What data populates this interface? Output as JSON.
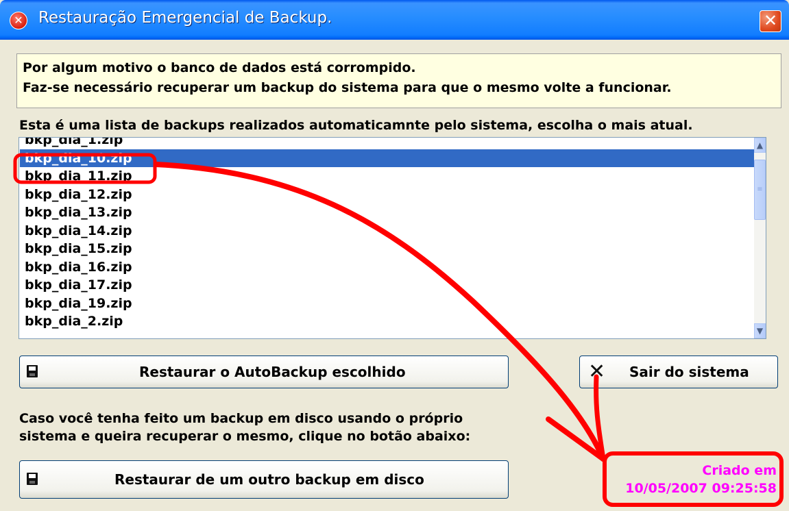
{
  "window": {
    "title": "Restauração Emergencial de Backup.",
    "close_icon": "close-icon",
    "title_icon": "error-icon"
  },
  "info": {
    "line1": "Por algum motivo o banco de dados está corrompido.",
    "line2": "Faz-se necessário recuperar um backup do sistema para que o mesmo volte a funcionar."
  },
  "backup_list": {
    "label": "Esta é uma lista de backups realizados automaticamnte pelo sistema, escolha o mais atual.",
    "items": [
      "bkp_dia_1.zip",
      "bkp_dia_10.zip",
      "bkp_dia_11.zip",
      "bkp_dia_12.zip",
      "bkp_dia_13.zip",
      "bkp_dia_14.zip",
      "bkp_dia_15.zip",
      "bkp_dia_16.zip",
      "bkp_dia_17.zip",
      "bkp_dia_19.zip",
      "bkp_dia_2.zip"
    ],
    "selected": "bkp_dia_10.zip"
  },
  "buttons": {
    "restore_auto": "Restaurar o AutoBackup escolhido",
    "exit": "Sair do sistema",
    "restore_disk": "Restaurar de um outro backup em disco"
  },
  "disk_note": {
    "line1": "Caso você tenha feito um backup em disco usando o próprio",
    "line2": "sistema e queira recuperar o mesmo, clique no botão abaixo:"
  },
  "created": {
    "label": "Criado em",
    "datetime": "10/05/2007 09:25:58"
  },
  "colors": {
    "titlebar": "#0058ee",
    "selection": "#316ac5",
    "info_bg": "#ffffe1",
    "created_text": "#ff00ff",
    "annotation": "#ff0000"
  }
}
